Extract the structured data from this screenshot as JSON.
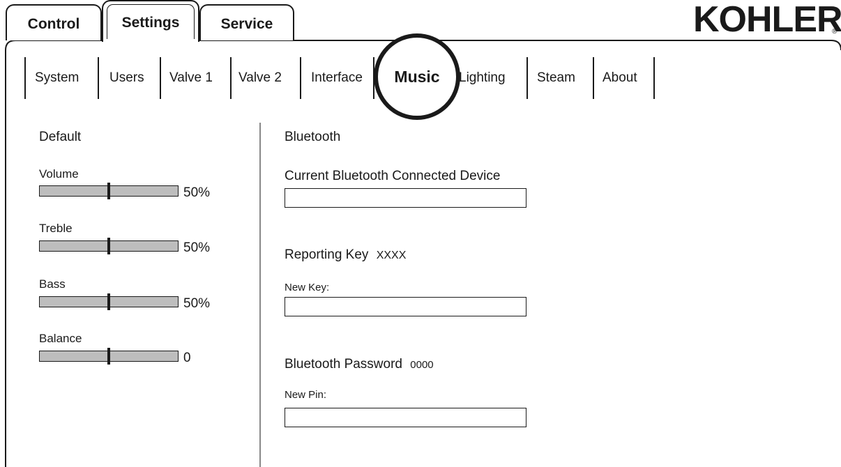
{
  "top_tabs": [
    {
      "label": "Control"
    },
    {
      "label": "Settings"
    },
    {
      "label": "Service"
    }
  ],
  "brand": {
    "logo": "KOHLER",
    "registered": "®"
  },
  "sub_tabs": [
    {
      "label": "System"
    },
    {
      "label": "Users"
    },
    {
      "label": "Valve 1"
    },
    {
      "label": "Valve 2"
    },
    {
      "label": "Interface"
    },
    {
      "label": "Music"
    },
    {
      "label": "Lighting"
    },
    {
      "label": "Steam"
    },
    {
      "label": "About"
    }
  ],
  "active_top_tab": "Settings",
  "active_sub_tab": "Music",
  "default_panel": {
    "title": "Default",
    "sliders": [
      {
        "label": "Volume",
        "value_text": "50%",
        "level": 0.5
      },
      {
        "label": "Treble",
        "value_text": "50%",
        "level": 0.5
      },
      {
        "label": "Bass",
        "value_text": "50%",
        "level": 0.5
      },
      {
        "label": "Balance",
        "value_text": "0",
        "level": 0.5
      }
    ]
  },
  "bluetooth": {
    "title": "Bluetooth",
    "connected_label": "Current Bluetooth Connected Device",
    "connected_value": "",
    "reporting_key_label": "Reporting Key",
    "reporting_key_value": "XXXX",
    "new_key_label": "New Key:",
    "new_key_value": "",
    "password_label": "Bluetooth Password",
    "password_value": "0000",
    "new_pin_label": "New Pin:",
    "new_pin_value": ""
  }
}
